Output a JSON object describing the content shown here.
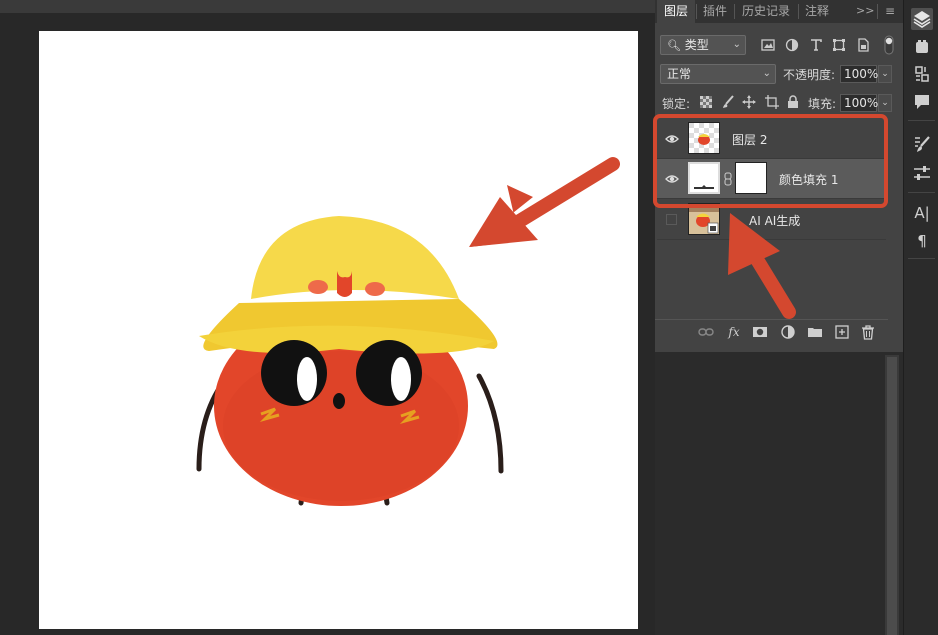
{
  "workspace": {
    "canvas_bg": "#ffffff",
    "mascot_desc_colors": {
      "hat": "#f4d33c",
      "body": "#e2462a",
      "cheek": "#f26b4a",
      "limbs": "#2a1e1a"
    }
  },
  "layers_panel": {
    "tabs": [
      {
        "label": "图层",
        "active": true
      },
      {
        "label": "插件",
        "active": false
      },
      {
        "label": "历史记录",
        "active": false
      },
      {
        "label": "注释",
        "active": false
      }
    ],
    "more_symbol": ">>",
    "menu_symbol": "≡",
    "filter": {
      "label": "类型",
      "icons": [
        "image-filter-icon",
        "adjustment-filter-icon",
        "type-filter-icon",
        "shape-filter-icon",
        "smartobject-filter-icon",
        "filter-toggle-icon"
      ]
    },
    "blend_mode": "正常",
    "opacity": {
      "label": "不透明度:",
      "value": "100%"
    },
    "lock": {
      "label": "锁定:",
      "icons": [
        "lock-transparent-icon",
        "lock-paint-icon",
        "lock-position-icon",
        "lock-artboard-icon",
        "lock-all-icon"
      ]
    },
    "fill": {
      "label": "填充:",
      "value": "100%"
    },
    "layers": [
      {
        "name": "图层 2",
        "visible": true,
        "selected": false
      },
      {
        "name": "颜色填充 1",
        "visible": true,
        "selected": true
      },
      {
        "name": "AI AI生成",
        "visible": false,
        "selected": false
      }
    ],
    "bottom_icons": [
      "link-layers-icon",
      "fx-icon",
      "add-mask-icon",
      "new-fill-adjustment-icon",
      "new-group-icon",
      "new-layer-icon",
      "delete-layer-icon"
    ],
    "fx_label": "fx"
  },
  "toolbar": {
    "icons": [
      "layers-panel-icon",
      "libraries-icon",
      "adjustments-icon",
      "comments-icon",
      "brush-settings-icon",
      "properties-icon",
      "character-icon",
      "paragraph-icon"
    ],
    "character_glyph": "A|",
    "paragraph_glyph": "¶"
  },
  "annotations": {
    "color": "#d4482f"
  }
}
